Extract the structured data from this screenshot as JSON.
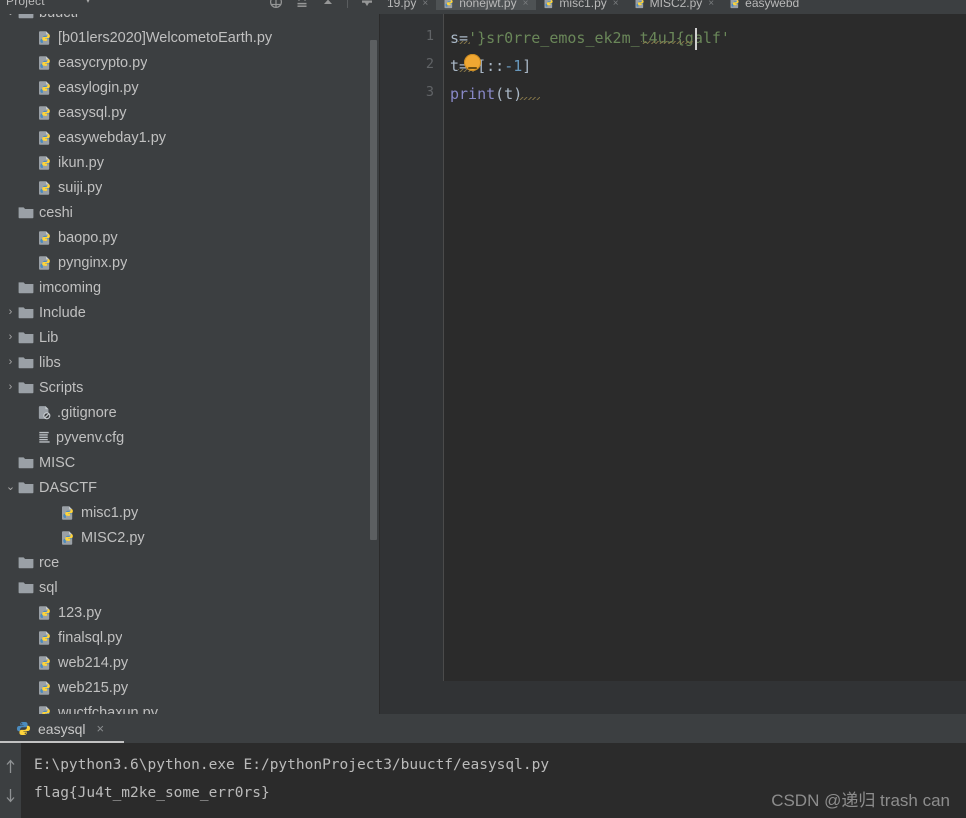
{
  "toolbar": {
    "title": "Project",
    "caret": "▾",
    "icons": [
      {
        "name": "target-locate-icon"
      },
      {
        "name": "collapse-all-icon"
      },
      {
        "name": "chevron-up-icon"
      },
      {
        "name": "settings-gear-icon"
      }
    ]
  },
  "editor_tabs": [
    {
      "label": "19.py",
      "icon": "python-file-icon",
      "active": false,
      "close": "×",
      "truncated_left": true
    },
    {
      "label": "nonejwt.py",
      "icon": "python-file-icon",
      "active": true,
      "close": "×"
    },
    {
      "label": "misc1.py",
      "icon": "python-file-icon",
      "active": false,
      "close": "×"
    },
    {
      "label": "MISC2.py",
      "icon": "python-file-icon",
      "active": false,
      "close": "×"
    },
    {
      "label": "easywebd",
      "icon": "python-file-icon",
      "active": false,
      "close": ""
    }
  ],
  "tree": [
    {
      "label": "buuctf",
      "indent": 0,
      "icon": "folder-icon",
      "arrow": "v",
      "partial": true
    },
    {
      "label": "[b01lers2020]WelcometoEarth.py",
      "indent": 1,
      "icon": "python-file-icon",
      "arrow": ""
    },
    {
      "label": "easycrypto.py",
      "indent": 1,
      "icon": "python-file-icon",
      "arrow": ""
    },
    {
      "label": "easylogin.py",
      "indent": 1,
      "icon": "python-file-icon",
      "arrow": ""
    },
    {
      "label": "easysql.py",
      "indent": 1,
      "icon": "python-file-icon",
      "arrow": ""
    },
    {
      "label": "easywebday1.py",
      "indent": 1,
      "icon": "python-file-icon",
      "arrow": ""
    },
    {
      "label": "ikun.py",
      "indent": 1,
      "icon": "python-file-icon",
      "arrow": ""
    },
    {
      "label": "suiji.py",
      "indent": 1,
      "icon": "python-file-icon",
      "arrow": ""
    },
    {
      "label": "ceshi",
      "indent": 0,
      "icon": "folder-icon",
      "arrow": ""
    },
    {
      "label": "baopo.py",
      "indent": 1,
      "icon": "python-file-icon",
      "arrow": ""
    },
    {
      "label": "pynginx.py",
      "indent": 1,
      "icon": "python-file-icon",
      "arrow": ""
    },
    {
      "label": "imcoming",
      "indent": 0,
      "icon": "folder-icon",
      "arrow": ""
    },
    {
      "label": "Include",
      "indent": 0,
      "icon": "folder-icon",
      "arrow": ">"
    },
    {
      "label": "Lib",
      "indent": 0,
      "icon": "folder-icon",
      "arrow": ">"
    },
    {
      "label": "libs",
      "indent": 0,
      "icon": "folder-icon",
      "arrow": ">"
    },
    {
      "label": "Scripts",
      "indent": 0,
      "icon": "folder-icon",
      "arrow": ">"
    },
    {
      "label": ".gitignore",
      "indent": 1,
      "icon": "ignored-file-icon",
      "arrow": ""
    },
    {
      "label": "pyvenv.cfg",
      "indent": 1,
      "icon": "config-file-icon",
      "arrow": ""
    },
    {
      "label": "MISC",
      "indent": 0,
      "icon": "folder-icon",
      "arrow": ""
    },
    {
      "label": "DASCTF",
      "indent": 0,
      "icon": "folder-icon",
      "arrow": "v"
    },
    {
      "label": "misc1.py",
      "indent": 2,
      "icon": "python-file-icon",
      "arrow": ""
    },
    {
      "label": "MISC2.py",
      "indent": 2,
      "icon": "python-file-icon",
      "arrow": ""
    },
    {
      "label": "rce",
      "indent": 0,
      "icon": "folder-icon",
      "arrow": ""
    },
    {
      "label": "sql",
      "indent": 0,
      "icon": "folder-icon",
      "arrow": ""
    },
    {
      "label": "123.py",
      "indent": 1,
      "icon": "python-file-icon",
      "arrow": ""
    },
    {
      "label": "finalsql.py",
      "indent": 1,
      "icon": "python-file-icon",
      "arrow": ""
    },
    {
      "label": "web214.py",
      "indent": 1,
      "icon": "python-file-icon",
      "arrow": ""
    },
    {
      "label": "web215.py",
      "indent": 1,
      "icon": "python-file-icon",
      "arrow": ""
    },
    {
      "label": "wuctfchaxun.py",
      "indent": 1,
      "icon": "python-file-icon",
      "arrow": ""
    }
  ],
  "editor": {
    "line_numbers": [
      "1",
      "2",
      "3"
    ],
    "lines": [
      {
        "tokens": [
          {
            "t": "s",
            "c": "var"
          },
          {
            "t": "=",
            "c": "op"
          },
          {
            "t": "'}sr0rre_emos_ek2m_t4uJ{galf'",
            "c": "str"
          }
        ]
      },
      {
        "tokens": [
          {
            "t": "t",
            "c": "var"
          },
          {
            "t": "=",
            "c": "op"
          },
          {
            "t": "s[::",
            "c": "var"
          },
          {
            "t": "-1",
            "c": "num"
          },
          {
            "t": "]",
            "c": "var"
          }
        ]
      },
      {
        "tokens": [
          {
            "t": "print",
            "c": "fn"
          },
          {
            "t": "(t)",
            "c": "var"
          }
        ]
      }
    ],
    "full_text": "s='}sr0rre_emos_ek2m_t4uJ{galf'\nt=s[::-1]\nprint(t)",
    "intention_bulb": "intention-lightbulb-icon"
  },
  "run_panel": {
    "tab": {
      "label": "easysql",
      "icon": "python-run-icon",
      "close": "×"
    },
    "gutter_icons": [
      {
        "name": "scroll-up-arrow-icon",
        "glyph": "↑"
      },
      {
        "name": "scroll-down-arrow-icon",
        "glyph": "↓"
      }
    ],
    "console_lines": [
      "E:\\python3.6\\python.exe E:/pythonProject3/buuctf/easysql.py",
      "flag{Ju4t_m2ke_some_err0rs}"
    ]
  },
  "watermark": "CSDN @递归 trash can",
  "colors": {
    "panel_bg": "#3c3f41",
    "editor_bg": "#2b2b2b",
    "gutter_bg": "#313335",
    "tab_active_bg": "#4e5254",
    "text": "#c0c0c0",
    "string_green": "#6a8759",
    "number_blue": "#6897bb",
    "keyword_violet": "#8888c6",
    "bulb_orange": "#f0a732"
  }
}
